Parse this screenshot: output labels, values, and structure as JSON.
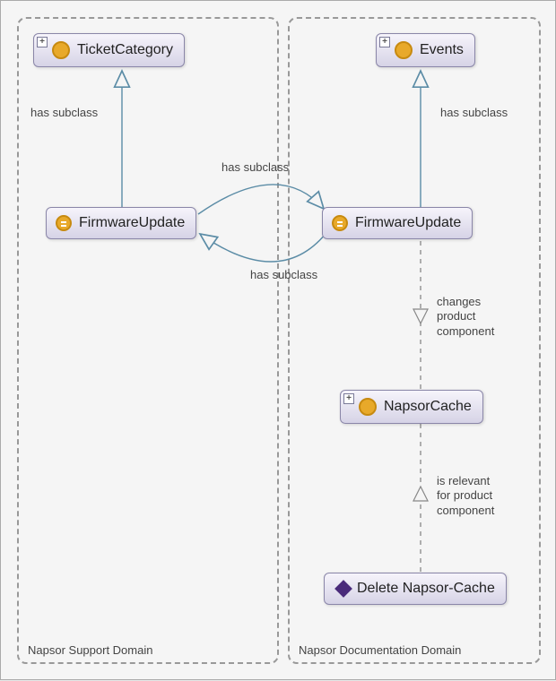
{
  "domains": {
    "left": {
      "label": "Napsor Support Domain"
    },
    "right": {
      "label": "Napsor Documentation Domain"
    }
  },
  "nodes": {
    "ticketCategory": {
      "label": "TicketCategory"
    },
    "events": {
      "label": "Events"
    },
    "firmwareLeft": {
      "label": "FirmwareUpdate"
    },
    "firmwareRight": {
      "label": "FirmwareUpdate"
    },
    "napsorCache": {
      "label": "NapsorCache"
    },
    "deleteCache": {
      "label": "Delete Napsor-Cache"
    }
  },
  "edges": {
    "hasSubclassLeft": "has subclass",
    "hasSubclassRight": "has subclass",
    "hasSubclassCrossTop": "has subclass",
    "hasSubclassCrossBottom": "has subclass",
    "changesProduct": "changes\nproduct\ncomponent",
    "relevantProduct": "is relevant\nfor product\ncomponent"
  }
}
